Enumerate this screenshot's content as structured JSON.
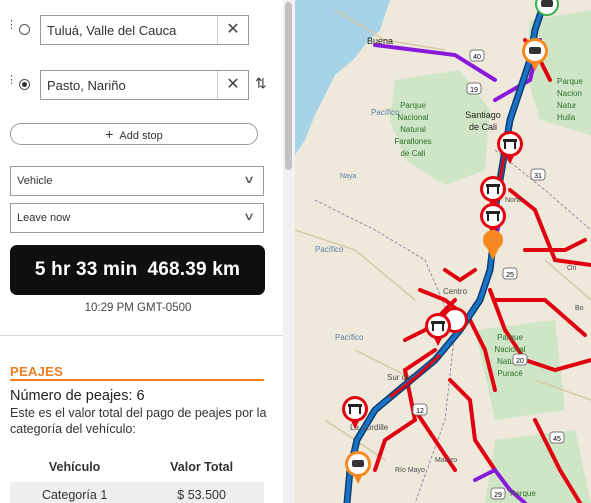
{
  "stops": [
    {
      "value": "Tuluá, Valle del Cauca",
      "selected": false
    },
    {
      "value": "Pasto, Nariño",
      "selected": true
    }
  ],
  "icons": {
    "drag": "drag-handle-icon",
    "clear": "close-icon",
    "swap": "swap-arrows-icon",
    "add": "plus-icon",
    "chevron": "chevron-down-icon",
    "toll": "toll-booth-icon"
  },
  "glyphs": {
    "clear": "✕",
    "swap": "⇅",
    "plus": "+",
    "chevron": "∨",
    "drag": "⋮"
  },
  "add_stop_label": "Add stop",
  "vehicle_select": "Vehicle",
  "leave_select": "Leave now",
  "summary": {
    "duration": "5 hr 33 min",
    "distance": "468.39 km"
  },
  "arrival_time": "10:29 PM GMT-0500",
  "peajes": {
    "title": "PEAJES",
    "count_label": "Número de peajes: 6",
    "description": "Este es el valor total del pago de peajes por la categoría del vehículo:",
    "headers": [
      "Vehículo",
      "Valor Total"
    ],
    "rows": [
      [
        "Categoría 1",
        "$ 53.500"
      ]
    ]
  },
  "map": {
    "labels": [
      "Buenaventura",
      "Parque Nacional Natural Farallones de Cali",
      "Santiago de Cali",
      "Parque Nacional Natural Puracé",
      "Pacífico",
      "Pacífico",
      "Pacífico",
      "Naya",
      "Parque Nacional Natural Huila",
      "Centro",
      "Sur del",
      "La Cordillera",
      "Macizo",
      "Río Mayo",
      "Parque",
      "Norte",
      "Ori",
      "Bo",
      "Oriente"
    ],
    "label_texts": {
      "buenaventura": "Buena",
      "farallones": [
        "Parque",
        "Nacional",
        "Natural",
        "Farallones",
        "de Cali"
      ],
      "cali": [
        "Santiago",
        "de Cali"
      ],
      "pacifico": "Pacífico",
      "naya": "Naya",
      "huila": [
        "Parque",
        "Nacion",
        "Natur",
        "Huila"
      ],
      "norte": "Norte",
      "centro": "Centro",
      "ori": "Ori",
      "bo": "Bo",
      "sur": "Sur del",
      "purace": [
        "Parque",
        "Nacional",
        "Natural",
        "Puracé"
      ],
      "cordillera": "La Cordille",
      "macizo": "Macizo",
      "rio_mayo": "Río Mayo",
      "parque_bottom": "Parque"
    },
    "route_numbers": [
      "40",
      "19",
      "31",
      "25",
      "20",
      "12",
      "45",
      "29"
    ],
    "colors": {
      "route": "#1a73c8",
      "congestion": "#e1000f",
      "slow": "#8a1adb",
      "toll": "#e1000f",
      "gas": "#f5891f",
      "water": "#a7d3e8",
      "park": "#cbe6c8"
    }
  },
  "colors": {
    "accent": "#f07d1e",
    "summary_bg": "#0f0f0f"
  }
}
